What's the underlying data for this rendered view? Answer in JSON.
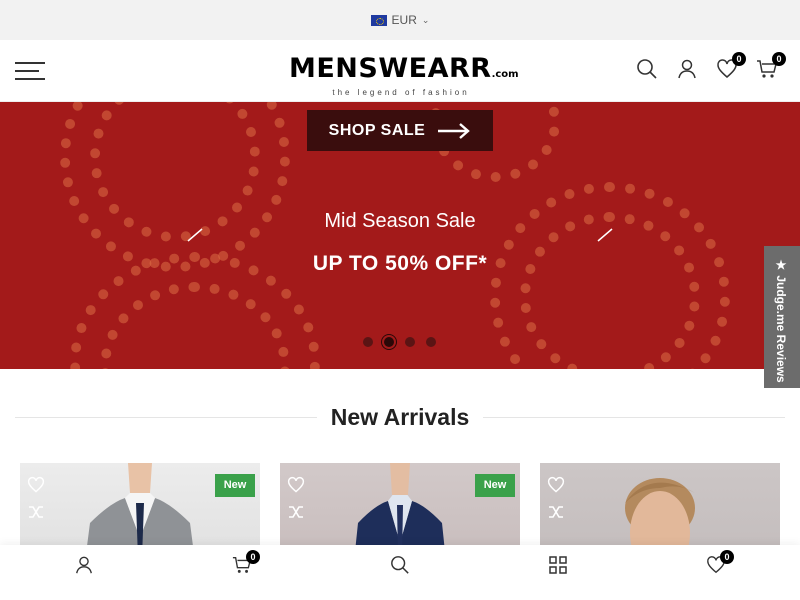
{
  "topbar": {
    "currency": "EUR",
    "flag_icon": "eu-flag-icon"
  },
  "header": {
    "logo_text": "MENSWEARR",
    "logo_suffix": ".com",
    "logo_tagline": "the legend of fashion",
    "wishlist_count": "0",
    "cart_count": "0"
  },
  "hero": {
    "button_label": "SHOP SALE",
    "subtitle": "Mid Season Sale",
    "title": "UP TO 50% OFF*",
    "slide_count": 4,
    "active_slide": 2,
    "background_color": "#a31a1a"
  },
  "judge_tab": {
    "label": "★ Judge.me Reviews"
  },
  "section": {
    "title": "New Arrivals"
  },
  "products": [
    {
      "badge": "New",
      "image_icon": "grey-suit-photo"
    },
    {
      "badge": "New",
      "image_icon": "navy-suit-photo"
    },
    {
      "badge": "",
      "image_icon": "model-portrait-photo"
    }
  ],
  "bottom_nav": {
    "cart_count": "0",
    "wishlist_count": "0"
  },
  "colors": {
    "accent_green": "#3aa14a",
    "badge_black": "#000000"
  }
}
